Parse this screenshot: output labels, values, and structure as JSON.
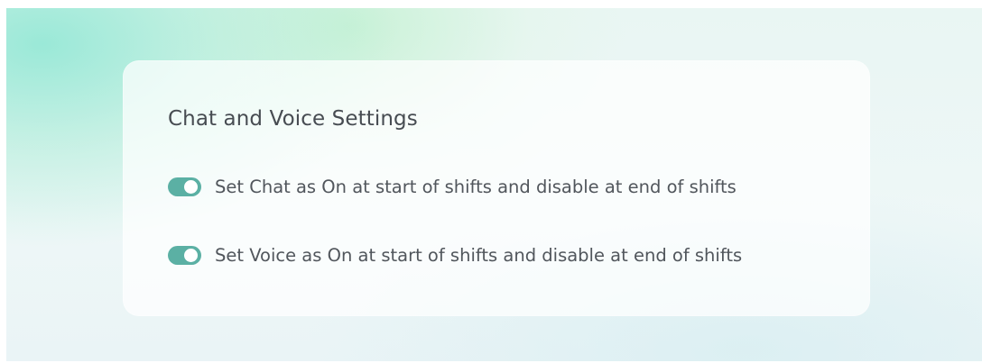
{
  "settings_card": {
    "title": "Chat and Voice Settings",
    "options": [
      {
        "label": "Set Chat as On at start of shifts and disable at end of shifts",
        "enabled": true
      },
      {
        "label": "Set Voice as On at start of shifts and disable at end of shifts",
        "enabled": true
      }
    ]
  },
  "colors": {
    "toggle_on": "#5bb0a4",
    "title_text": "#474c52",
    "label_text": "#51565c"
  }
}
